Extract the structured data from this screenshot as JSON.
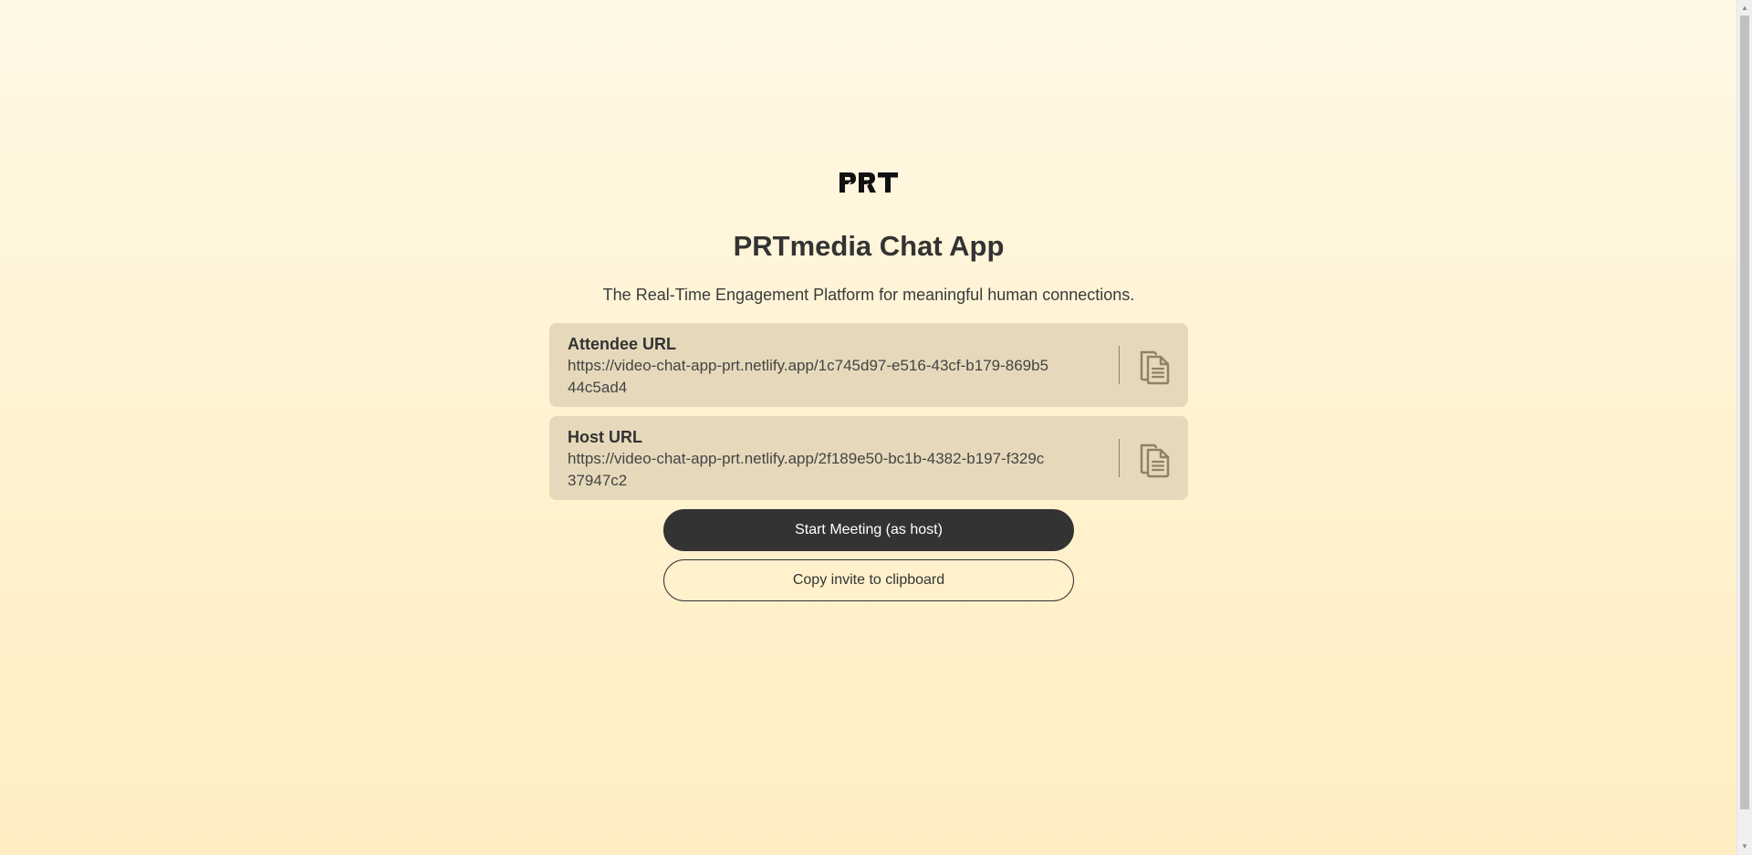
{
  "app": {
    "logo_text": "PRT",
    "title": "PRTmedia Chat App",
    "subtitle": "The Real-Time Engagement Platform for meaningful human connections."
  },
  "attendee": {
    "label": "Attendee URL",
    "url": "https://video-chat-app-prt.netlify.app/1c745d97-e516-43cf-b179-869b544c5ad4",
    "copy_icon": "copy-icon"
  },
  "host": {
    "label": "Host URL",
    "url": "https://video-chat-app-prt.netlify.app/2f189e50-bc1b-4382-b197-f329c37947c2",
    "copy_icon": "copy-icon"
  },
  "actions": {
    "start_label": "Start Meeting (as host)",
    "invite_label": "Copy invite to clipboard"
  },
  "colors": {
    "background_top": "#fff8e6",
    "background_bottom": "#ffeec2",
    "card": "#e6d9bb",
    "primary": "#333333",
    "icon": "#8c8369"
  }
}
